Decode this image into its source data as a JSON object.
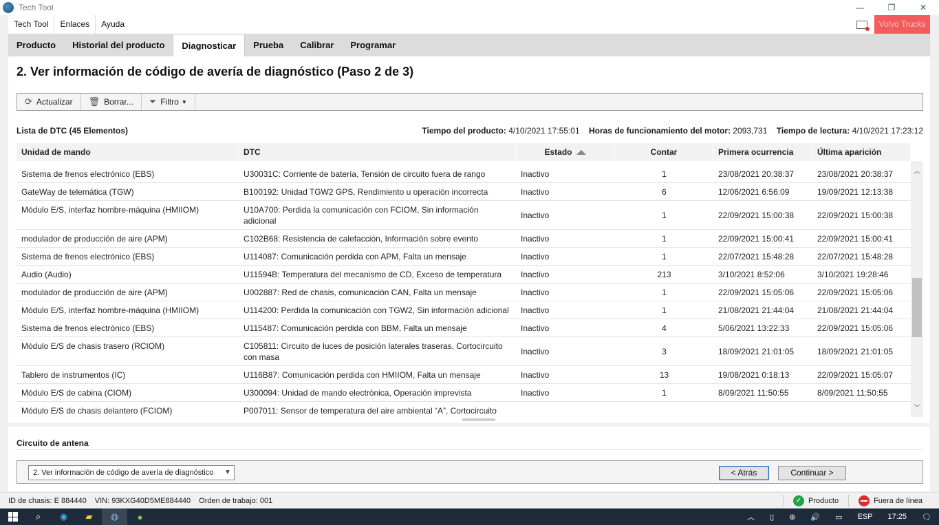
{
  "window": {
    "title": "Tech Tool"
  },
  "menu": {
    "items": [
      "Tech Tool",
      "Enlaces",
      "Ayuda"
    ],
    "brand": "Volvo Trucks"
  },
  "tabs": [
    "Producto",
    "Historial del producto",
    "Diagnosticar",
    "Prueba",
    "Calibrar",
    "Programar"
  ],
  "active_tab": "Diagnosticar",
  "page_title": "2. Ver información de código de avería de diagnóstico (Paso 2 de 3)",
  "toolbar": {
    "refresh": "Actualizar",
    "delete": "Borrar...",
    "filter": "Filtro"
  },
  "list": {
    "title": "Lista de DTC (45 Elementos)",
    "product_time_label": "Tiempo del producto:",
    "product_time": "4/10/2021 17:55:01",
    "engine_hours_label": "Horas de funcionamiento del motor:",
    "engine_hours": "2093,731",
    "read_time_label": "Tiempo de lectura:",
    "read_time": "4/10/2021 17:23:12"
  },
  "table": {
    "columns": [
      "Unidad de mando",
      "DTC",
      "Estado",
      "Contar",
      "Primera ocurrencia",
      "Última aparición"
    ],
    "rows": [
      {
        "unit": "Sistema de frenos electrónico (EBS)",
        "dtc": "U30031C: Corriente de batería, Tensión de circuito fuera de rango",
        "state": "Inactivo",
        "count": "1",
        "first": "23/08/2021 20:38:37",
        "last": "23/08/2021 20:38:37"
      },
      {
        "unit": "GateWay de telemática (TGW)",
        "dtc": "B100192: Unidad TGW2 GPS, Rendimiento u operación incorrecta",
        "state": "Inactivo",
        "count": "6",
        "first": "12/06/2021 6:56:09",
        "last": "19/09/2021 12:13:38"
      },
      {
        "unit": "Módulo E/S, interfaz hombre-máquina (HMIIOM)",
        "dtc": "U10A700: Perdida la comunicación con FCIOM, Sin información adicional",
        "state": "Inactivo",
        "count": "1",
        "first": "22/09/2021 15:00:38",
        "last": "22/09/2021 15:00:38"
      },
      {
        "unit": "modulador de producción de aire (APM)",
        "dtc": "C102B68: Resistencia de calefacción, Información sobre evento",
        "state": "Inactivo",
        "count": "1",
        "first": "22/09/2021 15:00:41",
        "last": "22/09/2021 15:00:41"
      },
      {
        "unit": "Sistema de frenos electrónico (EBS)",
        "dtc": "U114087: Comunicación perdida con APM, Falta un mensaje",
        "state": "Inactivo",
        "count": "1",
        "first": "22/07/2021 15:48:28",
        "last": "22/07/2021 15:48:28"
      },
      {
        "unit": "Audio (Audio)",
        "dtc": "U11594B: Temperatura del mecanismo de CD, Exceso de temperatura",
        "state": "Inactivo",
        "count": "213",
        "first": "3/10/2021 8:52:06",
        "last": "3/10/2021 19:28:46"
      },
      {
        "unit": "modulador de producción de aire (APM)",
        "dtc": "U002887: Red de chasis, comunicación CAN, Falta un mensaje",
        "state": "Inactivo",
        "count": "1",
        "first": "22/09/2021 15:05:06",
        "last": "22/09/2021 15:05:06"
      },
      {
        "unit": "Módulo E/S, interfaz hombre-máquina (HMIIOM)",
        "dtc": "U114200: Perdida la comunicación con TGW2, Sin información adicional",
        "state": "Inactivo",
        "count": "1",
        "first": "21/08/2021 21:44:04",
        "last": "21/08/2021 21:44:04"
      },
      {
        "unit": "Sistema de frenos electrónico (EBS)",
        "dtc": "U115487: Comunicación perdida con BBM, Falta un mensaje",
        "state": "Inactivo",
        "count": "4",
        "first": "5/06/2021 13:22:33",
        "last": "22/09/2021 15:05:06"
      },
      {
        "unit": "Módulo E/S de chasis trasero (RCIOM)",
        "dtc": "C105811: Circuito de luces de posición laterales traseras, Cortocircuito con masa",
        "state": "Inactivo",
        "count": "3",
        "first": "18/09/2021 21:01:05",
        "last": "18/09/2021 21:01:05"
      },
      {
        "unit": "Tablero de instrumentos (IC)",
        "dtc": "U116B87: Comunicación perdida con HMIIOM, Falta un mensaje",
        "state": "Inactivo",
        "count": "13",
        "first": "19/08/2021 0:18:13",
        "last": "22/09/2021 15:05:07"
      },
      {
        "unit": "Módulo E/S de cabina (CIOM)",
        "dtc": "U300094: Unidad de mando electrónica, Operación imprevista",
        "state": "Inactivo",
        "count": "1",
        "first": "8/09/2021 11:50:55",
        "last": "8/09/2021 11:50:55"
      },
      {
        "unit": "Módulo E/S de chasis delantero (FCIOM)",
        "dtc": "P007011: Sensor de temperatura del aire ambiental “A”, Cortocircuito",
        "state": "",
        "count": "",
        "first": "",
        "last": ""
      }
    ]
  },
  "lower": {
    "title": "Circuito de antena"
  },
  "nav": {
    "step_select": "2. Ver información de código de avería de diagnóstico",
    "back": "< Atrás",
    "next": "Continuar >"
  },
  "status": {
    "chassis": "ID de chasis: E 884440",
    "vin": "VIN: 93KXG40D5ME884440",
    "work_order": "Orden de trabajo: 001",
    "product": "Producto",
    "offline": "Fuera de línea"
  },
  "taskbar": {
    "lang": "ESP",
    "time": "17:25"
  },
  "colors": {
    "brand": "#f35c5c",
    "ok": "#22a34a",
    "offline": "#d92e2e",
    "taskbar": "#1f2a3a"
  }
}
